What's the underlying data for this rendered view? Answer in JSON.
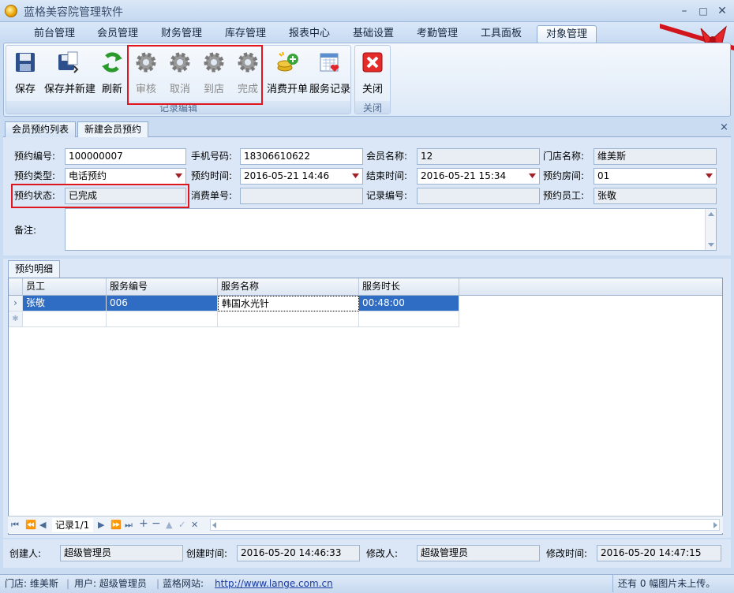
{
  "window": {
    "title": "蓝格美容院管理软件",
    "min": "–",
    "max": "□",
    "close": "✕"
  },
  "menu": {
    "tabs": [
      "前台管理",
      "会员管理",
      "财务管理",
      "库存管理",
      "报表中心",
      "基础设置",
      "考勤管理",
      "工具面板",
      "对象管理"
    ],
    "active": "对象管理"
  },
  "ribbon": {
    "save": "保存",
    "save_new": "保存并新建",
    "refresh": "刷新",
    "audit": "审核",
    "cancel": "取消",
    "arrive": "到店",
    "complete": "完成",
    "consume": "消费开单",
    "service_record": "服务记录",
    "group_edit": "记录编辑",
    "close": "关闭",
    "group_close": "关闭"
  },
  "subtabs": {
    "list": "会员预约列表",
    "new": "新建会员预约",
    "close": "×"
  },
  "form": {
    "no_label": "预约编号:",
    "no": "100000007",
    "phone_label": "手机号码:",
    "phone": "18306610622",
    "member_label": "会员名称:",
    "member": "12",
    "store_label": "门店名称:",
    "store": "维美斯",
    "type_label": "预约类型:",
    "type": "电话预约",
    "time_label": "预约时间:",
    "time": "2016-05-21 14:46",
    "end_label": "结束时间:",
    "end": "2016-05-21 15:34",
    "room_label": "预约房间:",
    "room": "01",
    "status_label": "预约状态:",
    "status": "已完成",
    "bill_label": "消费单号:",
    "bill": "",
    "record_label": "记录编号:",
    "record": "",
    "staff_label": "预约员工:",
    "staff": "张敬",
    "memo_label": "备注:"
  },
  "detail": {
    "tab": "预约明细",
    "columns": [
      "员工",
      "服务编号",
      "服务名称",
      "服务时长"
    ],
    "rows": [
      [
        "张敬",
        "006",
        "韩国水光针",
        "00:48:00"
      ]
    ],
    "record_text": "记录1/1"
  },
  "footer": {
    "creator_label": "创建人:",
    "creator": "超级管理员",
    "ctime_label": "创建时间:",
    "ctime": "2016-05-20 14:46:33",
    "modifier_label": "修改人:",
    "modifier": "超级管理员",
    "mtime_label": "修改时间:",
    "mtime": "2016-05-20 14:47:15"
  },
  "status": {
    "store": "门店: 维美斯",
    "user": "用户: 超级管理员",
    "site_label": "蓝格网站:",
    "site": "http://www.lange.com.cn",
    "upload": "还有 0 幅图片未上传。"
  },
  "colors": {
    "accent_red": "#e0161e",
    "selection": "#2f6cc3"
  }
}
